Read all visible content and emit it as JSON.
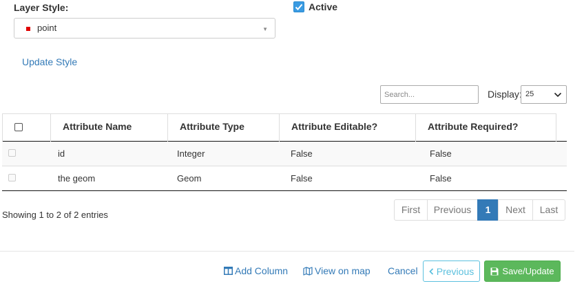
{
  "layer_style": {
    "label": "Layer Style:",
    "selected": "point",
    "swatch_color": "#e00000"
  },
  "active": {
    "label": "Active",
    "checked": true
  },
  "update_style": "Update Style",
  "table_controls": {
    "search_placeholder": "Search...",
    "display_label": "Display:",
    "display_value": "25"
  },
  "table": {
    "columns": [
      "Attribute Name",
      "Attribute Type",
      "Attribute Editable?",
      "Attribute Required?"
    ],
    "rows": [
      {
        "name": "id",
        "type": "Integer",
        "editable": "False",
        "required": "False"
      },
      {
        "name": "the geom",
        "type": "Geom",
        "editable": "False",
        "required": "False"
      }
    ]
  },
  "showing_text": "Showing 1 to 2 of 2 entries",
  "pagination": {
    "first": "First",
    "previous": "Previous",
    "current": "1",
    "next": "Next",
    "last": "Last"
  },
  "footer": {
    "add_column": "Add Column",
    "view_on_map": "View on map",
    "cancel": "Cancel",
    "previous": "Previous",
    "save_update": "Save/Update"
  },
  "colors": {
    "link": "#337ab7",
    "info": "#5bc0de",
    "success": "#5cb85c",
    "active_page": "#337ab7"
  },
  "icons": {
    "add_column": "columns-icon",
    "view_on_map": "map-icon",
    "previous": "chevron-left-icon",
    "save": "floppy-disk-icon"
  }
}
